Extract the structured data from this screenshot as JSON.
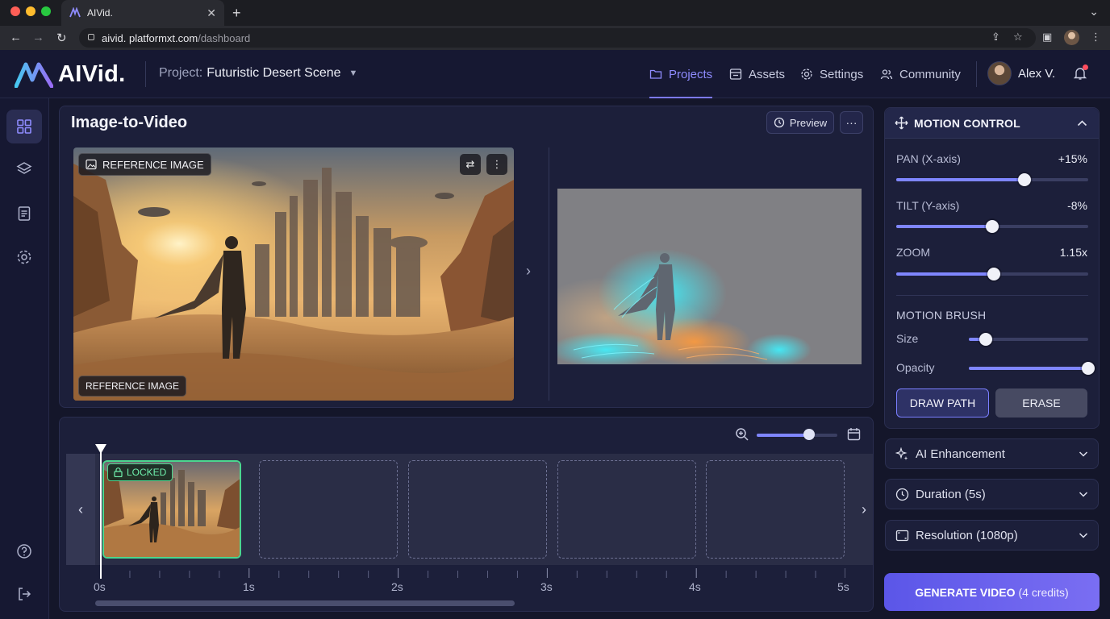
{
  "browser": {
    "tab_title": "AIVid.",
    "url_host": "aivid. platformxt.com",
    "url_path": "/dashboard"
  },
  "header": {
    "logo_text": "AIVid.",
    "project_label": "Project:",
    "project_name": "Futuristic Desert Scene",
    "nav": [
      {
        "label": "Projects",
        "icon": "folder-icon",
        "active": true
      },
      {
        "label": "Assets",
        "icon": "image-icon",
        "active": false
      },
      {
        "label": "Settings",
        "icon": "gear-icon",
        "active": false
      },
      {
        "label": "Community",
        "icon": "users-icon",
        "active": false
      }
    ],
    "user_name": "Alex V."
  },
  "main": {
    "title": "Image-to-Video",
    "preview_label": "Preview",
    "ref_badge_top": "REFERENCE IMAGE",
    "ref_badge_bottom": "REFERENCE IMAGE"
  },
  "timeline": {
    "zoom_level": 0.65,
    "locked_label": "LOCKED",
    "tick_labels": [
      "0s",
      "1s",
      "2s",
      "3s",
      "4s",
      "5s"
    ]
  },
  "motion_control": {
    "title": "MOTION CONTROL",
    "pan": {
      "label": "PAN (X-axis)",
      "value": "+15%",
      "level": 0.67
    },
    "tilt": {
      "label": "TILT (Y-axis)",
      "value": "-8%",
      "level": 0.5
    },
    "zoom": {
      "label": "ZOOM",
      "value": "1.15x",
      "level": 0.51
    },
    "brush_title": "MOTION BRUSH",
    "size": {
      "label": "Size",
      "level": 0.14
    },
    "opacity": {
      "label": "Opacity",
      "level": 1.0
    },
    "draw_path_label": "DRAW PATH",
    "erase_label": "ERASE"
  },
  "accordions": [
    {
      "label": "AI Enhancement",
      "icon": "sparkle-icon"
    },
    {
      "label": "Duration (5s)",
      "icon": "clock-icon"
    },
    {
      "label": "Resolution (1080p)",
      "icon": "resolution-icon"
    }
  ],
  "generate": {
    "label": "GENERATE VIDEO",
    "credits": "(4 credits)"
  },
  "colors": {
    "accent": "#7f86ff",
    "locked": "#4bd68f",
    "background": "#14162a"
  }
}
